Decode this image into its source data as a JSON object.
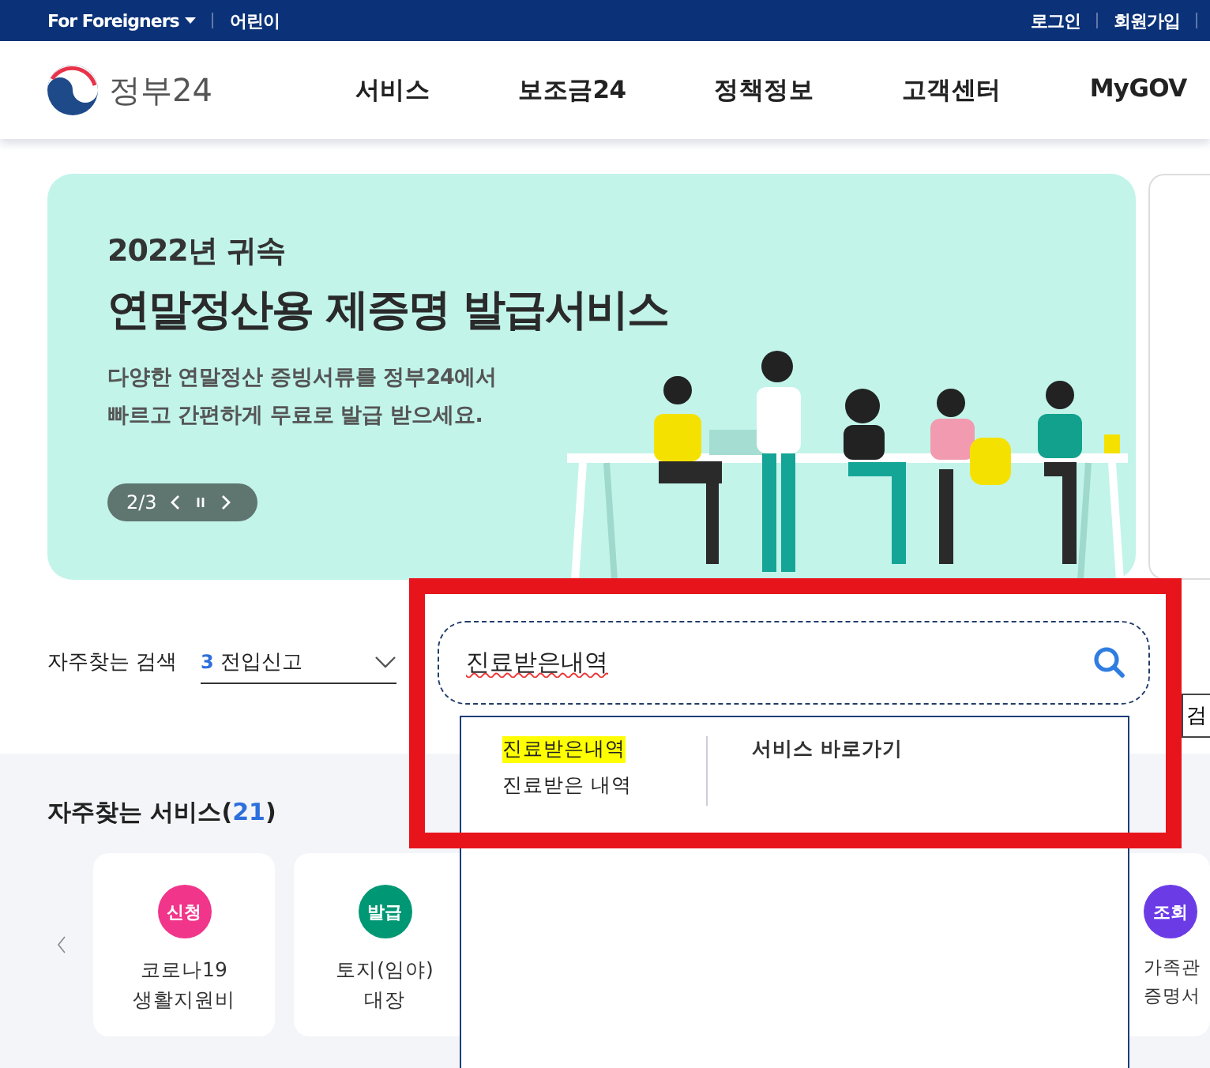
{
  "top_bar": {
    "left": [
      {
        "label": "For Foreigners",
        "kind": "dropdown"
      },
      {
        "label": "어린이",
        "kind": "link"
      }
    ],
    "right": [
      "로그인",
      "회원가입"
    ]
  },
  "header": {
    "logo_text": "정부24",
    "nav": [
      "서비스",
      "보조금24",
      "정책정보",
      "고객센터",
      "MyGOV"
    ]
  },
  "banner": {
    "subtitle": "2022년 귀속",
    "title": "연말정산용 제증명 발급서비스",
    "description_lines": [
      "다양한 연말정산 증빙서류를 정부24에서",
      "빠르고 간편하게 무료로 발급 받으세요."
    ],
    "pager": "2/3"
  },
  "search": {
    "label": "자주찾는 검색",
    "popular": {
      "rank": "3",
      "term": "전입신고"
    },
    "value": "진료받은내역",
    "side_button": "검"
  },
  "autocomplete": {
    "suggestions": [
      {
        "text": "진료받은내역",
        "highlighted": true
      },
      {
        "text": "진료받은 내역",
        "highlighted": false
      }
    ],
    "shortcut_heading": "서비스 바로가기"
  },
  "services": {
    "title": "자주찾는 서비스(",
    "count": "21",
    "title_end": ")",
    "items": [
      {
        "badge": "신청",
        "color": "#f0358a",
        "lines": [
          "코로나19",
          "생활지원비"
        ]
      },
      {
        "badge": "발급",
        "color": "#009874",
        "lines": [
          "토지(임야)",
          "대장"
        ]
      },
      {
        "badge": "조회",
        "color": "#6b3ce6",
        "lines": [
          "가족관",
          "증명서"
        ]
      }
    ]
  }
}
